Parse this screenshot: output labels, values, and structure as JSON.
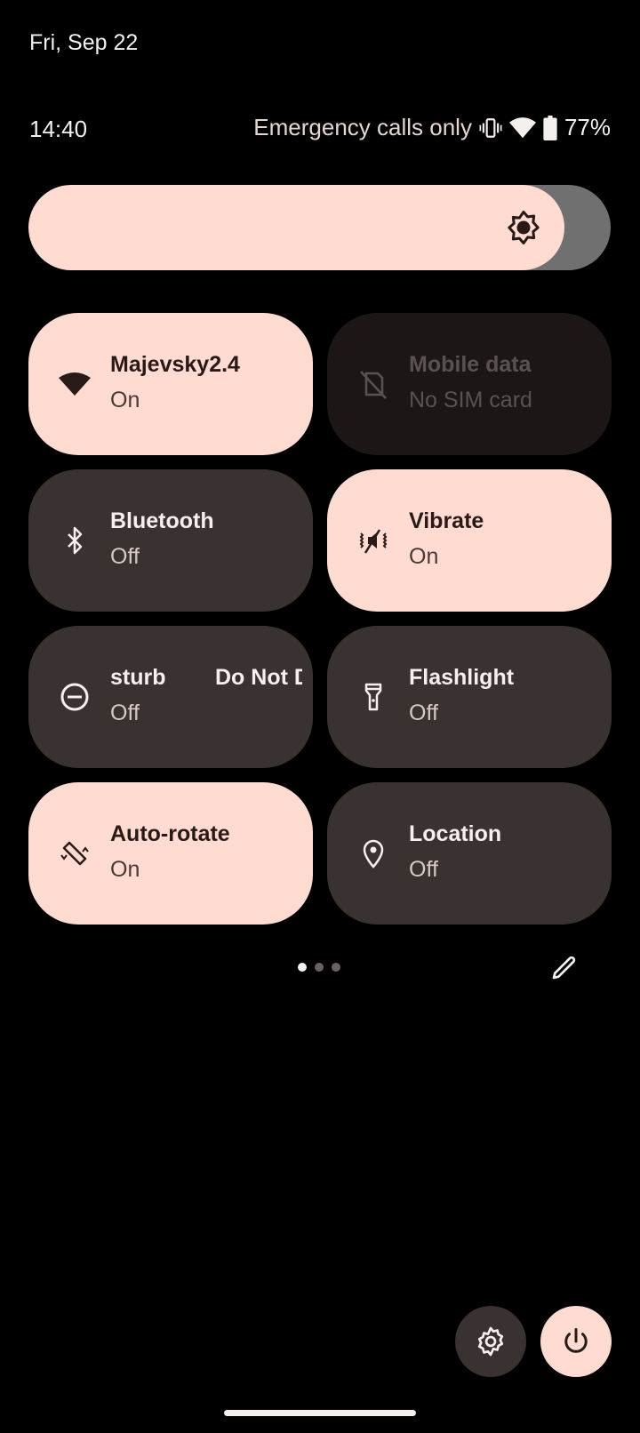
{
  "header": {
    "date": "Fri, Sep 22",
    "time": "14:40",
    "network_status": "Emergency calls only",
    "battery_percent": "77%",
    "icons": [
      "vibrate-icon",
      "wifi-icon",
      "battery-icon"
    ]
  },
  "brightness": {
    "level_percent": 92,
    "icon": "brightness-icon"
  },
  "tiles": [
    {
      "title": "Majevsky2.4",
      "subtitle": "On",
      "state": "on",
      "icon": "wifi-icon"
    },
    {
      "title": "Mobile data",
      "subtitle": "No SIM card",
      "state": "unavailable",
      "icon": "no-sim-icon"
    },
    {
      "title": "Bluetooth",
      "subtitle": "Off",
      "state": "off",
      "icon": "bluetooth-icon"
    },
    {
      "title": "Vibrate",
      "subtitle": "On",
      "state": "on",
      "icon": "vibrate-mute-icon"
    },
    {
      "title": "Do Not Disturb",
      "title_visible_a": "sturb",
      "title_visible_b": "Do N",
      "subtitle": "Off",
      "state": "off",
      "icon": "do-not-disturb-icon"
    },
    {
      "title": "Flashlight",
      "subtitle": "Off",
      "state": "off",
      "icon": "flashlight-icon"
    },
    {
      "title": "Auto-rotate",
      "subtitle": "On",
      "state": "on",
      "icon": "auto-rotate-icon"
    },
    {
      "title": "Location",
      "subtitle": "Off",
      "state": "off",
      "icon": "location-icon"
    }
  ],
  "pager": {
    "pages": 3,
    "current": 1
  },
  "colors": {
    "accent": "#ffdbd1",
    "tile_off": "#3a3230",
    "tile_unavailable": "#1c1716",
    "background": "#000000"
  }
}
